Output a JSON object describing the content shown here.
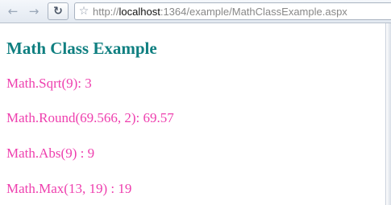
{
  "browser": {
    "url": {
      "protocol": "http://",
      "host": "localhost",
      "rest": ":1364/example/MathClassExample.aspx"
    },
    "icons": {
      "back": "back-arrow-icon",
      "forward": "forward-arrow-icon",
      "reload": "reload-icon",
      "bookmark": "star-icon"
    }
  },
  "page": {
    "title": "Math Class Example",
    "results": [
      "Math.Sqrt(9): 3",
      "Math.Round(69.566, 2): 69.57",
      "Math.Abs(9) : 9",
      "Math.Max(13, 19) : 19"
    ]
  },
  "colors": {
    "title": "#0f7f80",
    "result_text": "#ee3fae"
  }
}
